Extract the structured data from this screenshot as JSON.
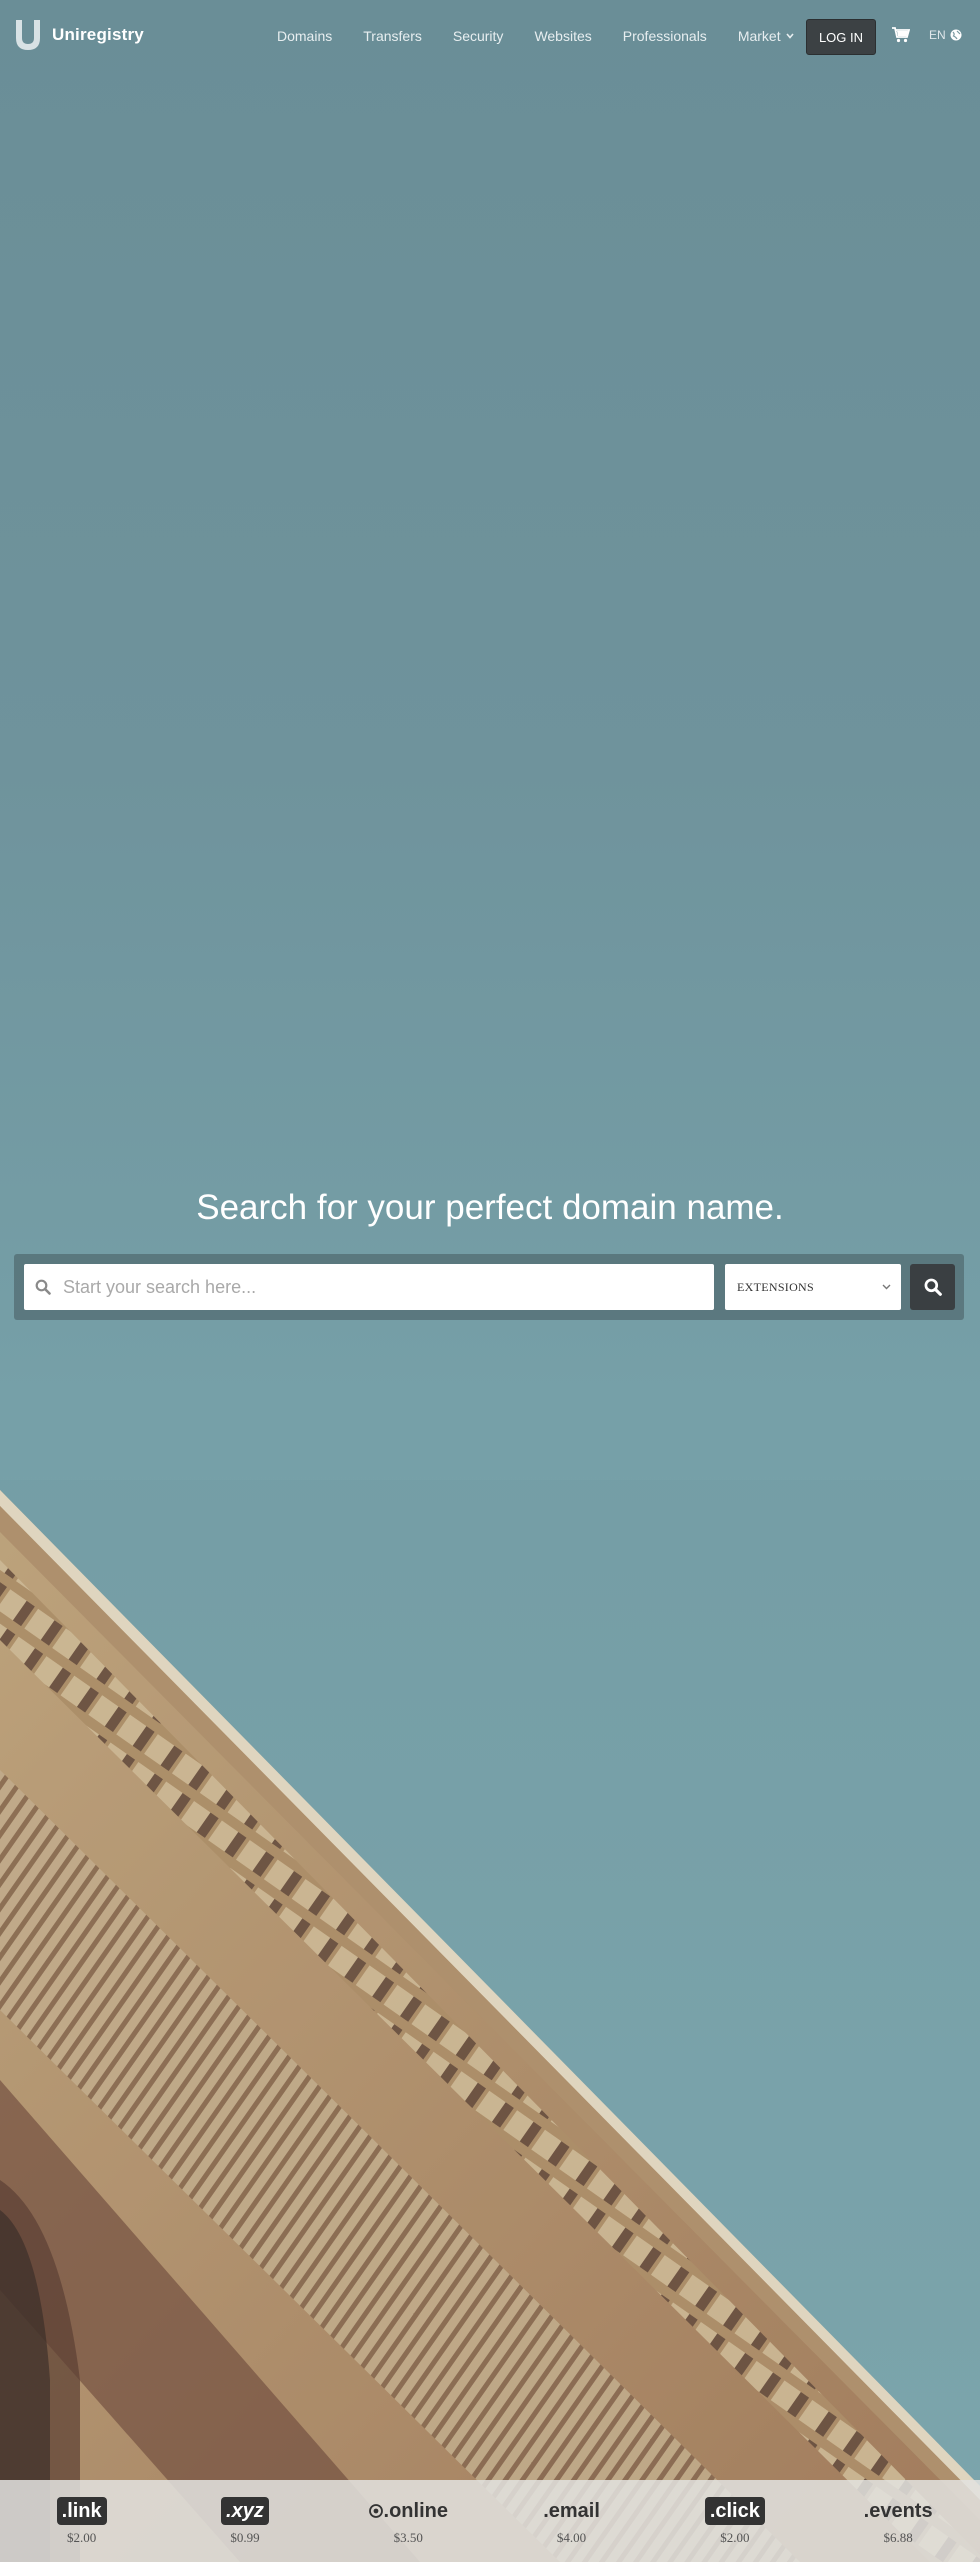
{
  "brand": {
    "name": "Uniregistry"
  },
  "nav": {
    "items": [
      "Domains",
      "Transfers",
      "Security",
      "Websites",
      "Professionals"
    ],
    "market_label": "Market",
    "login_label": "LOG IN",
    "lang_label": "EN"
  },
  "hero": {
    "title": "Search for your perfect domain name.",
    "search_placeholder": "Start your search here...",
    "extensions_label": "EXTENSIONS"
  },
  "tlds": [
    {
      "name": ".link",
      "price": "$2.00"
    },
    {
      "name": ".xyz",
      "price": "$0.99"
    },
    {
      "name": ".online",
      "price": "$3.50"
    },
    {
      "name": ".email",
      "price": "$4.00"
    },
    {
      "name": ".click",
      "price": "$2.00"
    },
    {
      "name": ".events",
      "price": "$6.88"
    }
  ],
  "colors": {
    "sky": "#6f939c",
    "button_dark": "#3a3f42",
    "stone": "#c9ab80"
  },
  "icons": [
    "logo-icon",
    "chevron-down-icon",
    "cart-icon",
    "globe-icon",
    "search-icon"
  ]
}
